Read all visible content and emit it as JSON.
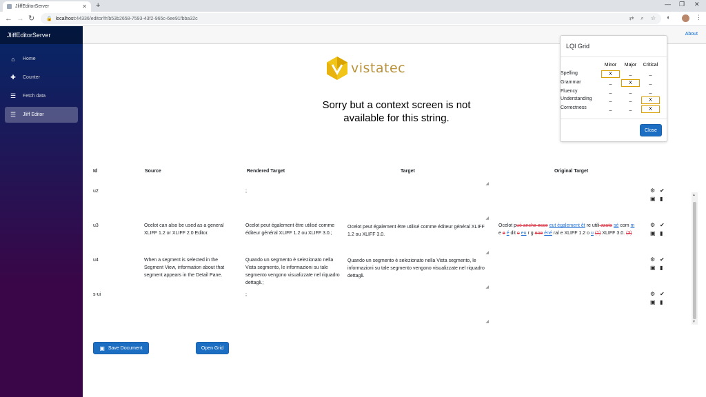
{
  "browser": {
    "tab_title": "JliffEditorServer",
    "tab_close": "✕",
    "new_tab": "+",
    "url_host": "localhost",
    "url_path": ":44336/editor/fr/b53b2658-7593-43f2-965c-6ee91fbba32c",
    "win_min": "—",
    "win_restore": "❐",
    "win_close": "✕"
  },
  "sidebar": {
    "brand": "JliffEditorServer",
    "items": [
      {
        "label": "Home",
        "icon": "home-icon"
      },
      {
        "label": "Counter",
        "icon": "plus-icon"
      },
      {
        "label": "Fetch data",
        "icon": "list-icon"
      },
      {
        "label": "Jliff Editor",
        "icon": "list-icon"
      }
    ]
  },
  "topbar": {
    "about": "About"
  },
  "logo_text": "vistatec",
  "context_message": "Sorry but a context screen is not available for this string.",
  "table": {
    "headers": {
      "id": "Id",
      "source": "Source",
      "rendered": "Rendered Target",
      "target": "Target",
      "original": "Original Target"
    },
    "rows": [
      {
        "id": "u2",
        "source": "",
        "rendered": ";",
        "target": ""
      },
      {
        "id": "u3",
        "source": "Ocelot can also be used as a general XLIFF 1.2 or XLIFF 2.0 Editor.",
        "rendered": "Ocelot peut également être utilisé comme éditeur général XLIFF 1.2 ou XLIFF 3.0.;",
        "target": "Ocelot peut également être utilisé comme éditeur général XLIFF 1.2 ou XLIFF 3.0."
      },
      {
        "id": "u4",
        "source": "When a segment is selected in the Segment View, information about that segment appears in the Detail Pane.",
        "rendered": "Quando un segmento è selezionato nella Vista segmento, le informazioni su tale segmento vengono visualizzate nel riquadro dettagli.;",
        "target": "Quando un segmento è selezionato nella Vista segmento, le informazioni su tale segmento vengono visualizzate nel riquadro dettagli."
      },
      {
        "id": "s-ui",
        "source": "",
        "rendered": ";",
        "target": ""
      }
    ],
    "original_target": {
      "segments": [
        {
          "t": "Ocelot p",
          "k": "n"
        },
        {
          "t": "uò anche esse",
          "k": "d"
        },
        {
          "t": " ",
          "k": "n"
        },
        {
          "t": "eut également êt",
          "k": "i"
        },
        {
          "t": " re utili",
          "k": "n"
        },
        {
          "t": " zzato",
          "k": "d"
        },
        {
          "t": " ",
          "k": "n"
        },
        {
          "t": "sé",
          "k": "i"
        },
        {
          "t": " com ",
          "k": "n"
        },
        {
          "t": "m",
          "k": "i"
        },
        {
          "t": " e ",
          "k": "n"
        },
        {
          "t": "e",
          "k": "d"
        },
        {
          "t": " ",
          "k": "n"
        },
        {
          "t": "é",
          "k": "i"
        },
        {
          "t": " dit ",
          "k": "n"
        },
        {
          "t": "o",
          "k": "d"
        },
        {
          "t": " ",
          "k": "n"
        },
        {
          "t": "eu",
          "k": "i"
        },
        {
          "t": " r g ",
          "k": "n"
        },
        {
          "t": "ene",
          "k": "d"
        },
        {
          "t": " ",
          "k": "n"
        },
        {
          "t": "éné",
          "k": "i"
        },
        {
          "t": " ral e XLIFF 1.2 o ",
          "k": "n"
        },
        {
          "t": "u",
          "k": "i"
        },
        {
          "t": " ",
          "k": "n"
        },
        {
          "t": "(1)",
          "k": "d"
        },
        {
          "t": " XLIFF 3.0. ",
          "k": "n"
        },
        {
          "t": "(3)",
          "k": "d"
        }
      ]
    }
  },
  "buttons": {
    "save": "Save Document",
    "open_grid": "Open Grid"
  },
  "lqi": {
    "title": "LQI Grid",
    "columns": [
      "Minor",
      "Major",
      "Critical"
    ],
    "column_colors": [
      "#5ee35e",
      "#ffd966",
      "#ff6b6b"
    ],
    "categories": [
      "Spelling",
      "Grammar",
      "Fluency",
      "Understanding",
      "Correctness"
    ],
    "cells": [
      [
        "X",
        "_",
        "_"
      ],
      [
        "_",
        "X",
        "_"
      ],
      [
        "_",
        "_",
        "_"
      ],
      [
        "_",
        "_",
        "X"
      ],
      [
        "_",
        "_",
        "X"
      ]
    ],
    "close": "Close"
  }
}
